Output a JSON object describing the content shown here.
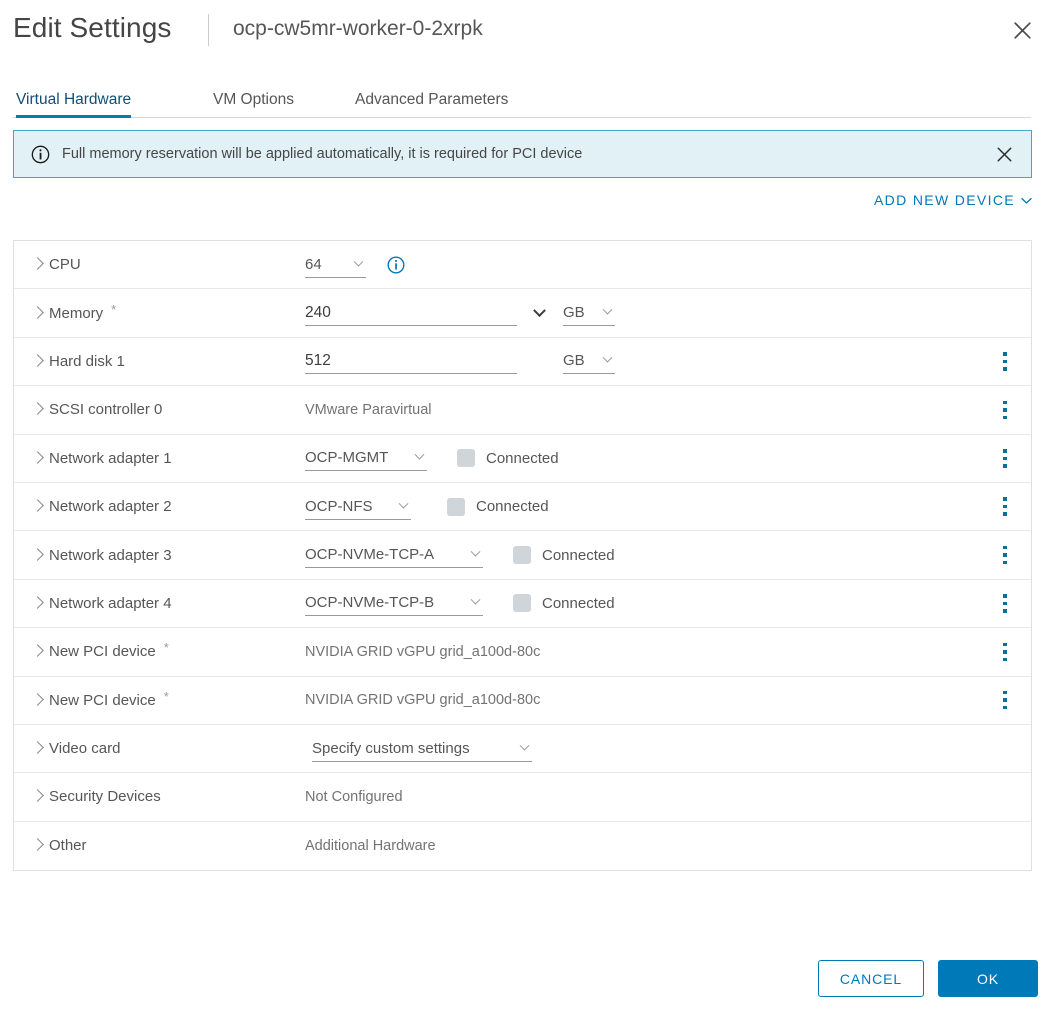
{
  "header": {
    "title": "Edit Settings",
    "vm_name": "ocp-cw5mr-worker-0-2xrpk",
    "close_label": "Close"
  },
  "tabs": [
    {
      "label": "Virtual Hardware",
      "active": true
    },
    {
      "label": "VM Options",
      "active": false
    },
    {
      "label": "Advanced Parameters",
      "active": false
    }
  ],
  "banner": {
    "message": "Full memory reservation will be applied automatically, it is required for PCI device",
    "icon": "info-circle-icon",
    "close_label": "Dismiss",
    "border_color": "#45a5c6",
    "background_color": "#e1f1f6"
  },
  "add_new_device": {
    "label": "ADD NEW DEVICE",
    "caret": "chevron-down-icon",
    "color": "#0079b8"
  },
  "devices": [
    {
      "label": "CPU",
      "required": false,
      "control": "select",
      "value": "64",
      "info_icon": true,
      "kebab": false
    },
    {
      "label": "Memory",
      "required": true,
      "control": "memory",
      "value": "240",
      "unit": "GB",
      "kebab": false
    },
    {
      "label": "Hard disk 1",
      "required": false,
      "control": "disk",
      "value": "512",
      "unit": "GB",
      "kebab": true
    },
    {
      "label": "SCSI controller 0",
      "required": false,
      "control": "text",
      "value": "VMware Paravirtual",
      "kebab": true
    },
    {
      "label": "Network adapter 1",
      "required": false,
      "control": "network",
      "value": "OCP-MGMT",
      "checkbox_label": "Connected",
      "checked": false,
      "kebab": true
    },
    {
      "label": "Network adapter 2",
      "required": false,
      "control": "network",
      "value": "OCP-NFS",
      "checkbox_label": "Connected",
      "checked": false,
      "kebab": true
    },
    {
      "label": "Network adapter 3",
      "required": false,
      "control": "network",
      "value": "OCP-NVMe-TCP-A",
      "checkbox_label": "Connected",
      "checked": false,
      "kebab": true
    },
    {
      "label": "Network adapter 4",
      "required": false,
      "control": "network",
      "value": "OCP-NVMe-TCP-B",
      "checkbox_label": "Connected",
      "checked": false,
      "kebab": true
    },
    {
      "label": "New PCI device",
      "required": true,
      "control": "text",
      "value": "NVIDIA GRID vGPU grid_a100d-80c",
      "kebab": true
    },
    {
      "label": "New PCI device",
      "required": true,
      "control": "text",
      "value": "NVIDIA GRID vGPU grid_a100d-80c",
      "kebab": true
    },
    {
      "label": "Video card",
      "required": false,
      "control": "select",
      "value": "Specify custom settings",
      "kebab": false
    },
    {
      "label": "Security Devices",
      "required": false,
      "control": "text",
      "value": "Not Configured",
      "kebab": false
    },
    {
      "label": "Other",
      "required": false,
      "control": "text",
      "value": "Additional Hardware",
      "kebab": false
    }
  ],
  "footer": {
    "cancel_label": "CANCEL",
    "ok_label": "OK",
    "accent_color": "#0079b8"
  }
}
